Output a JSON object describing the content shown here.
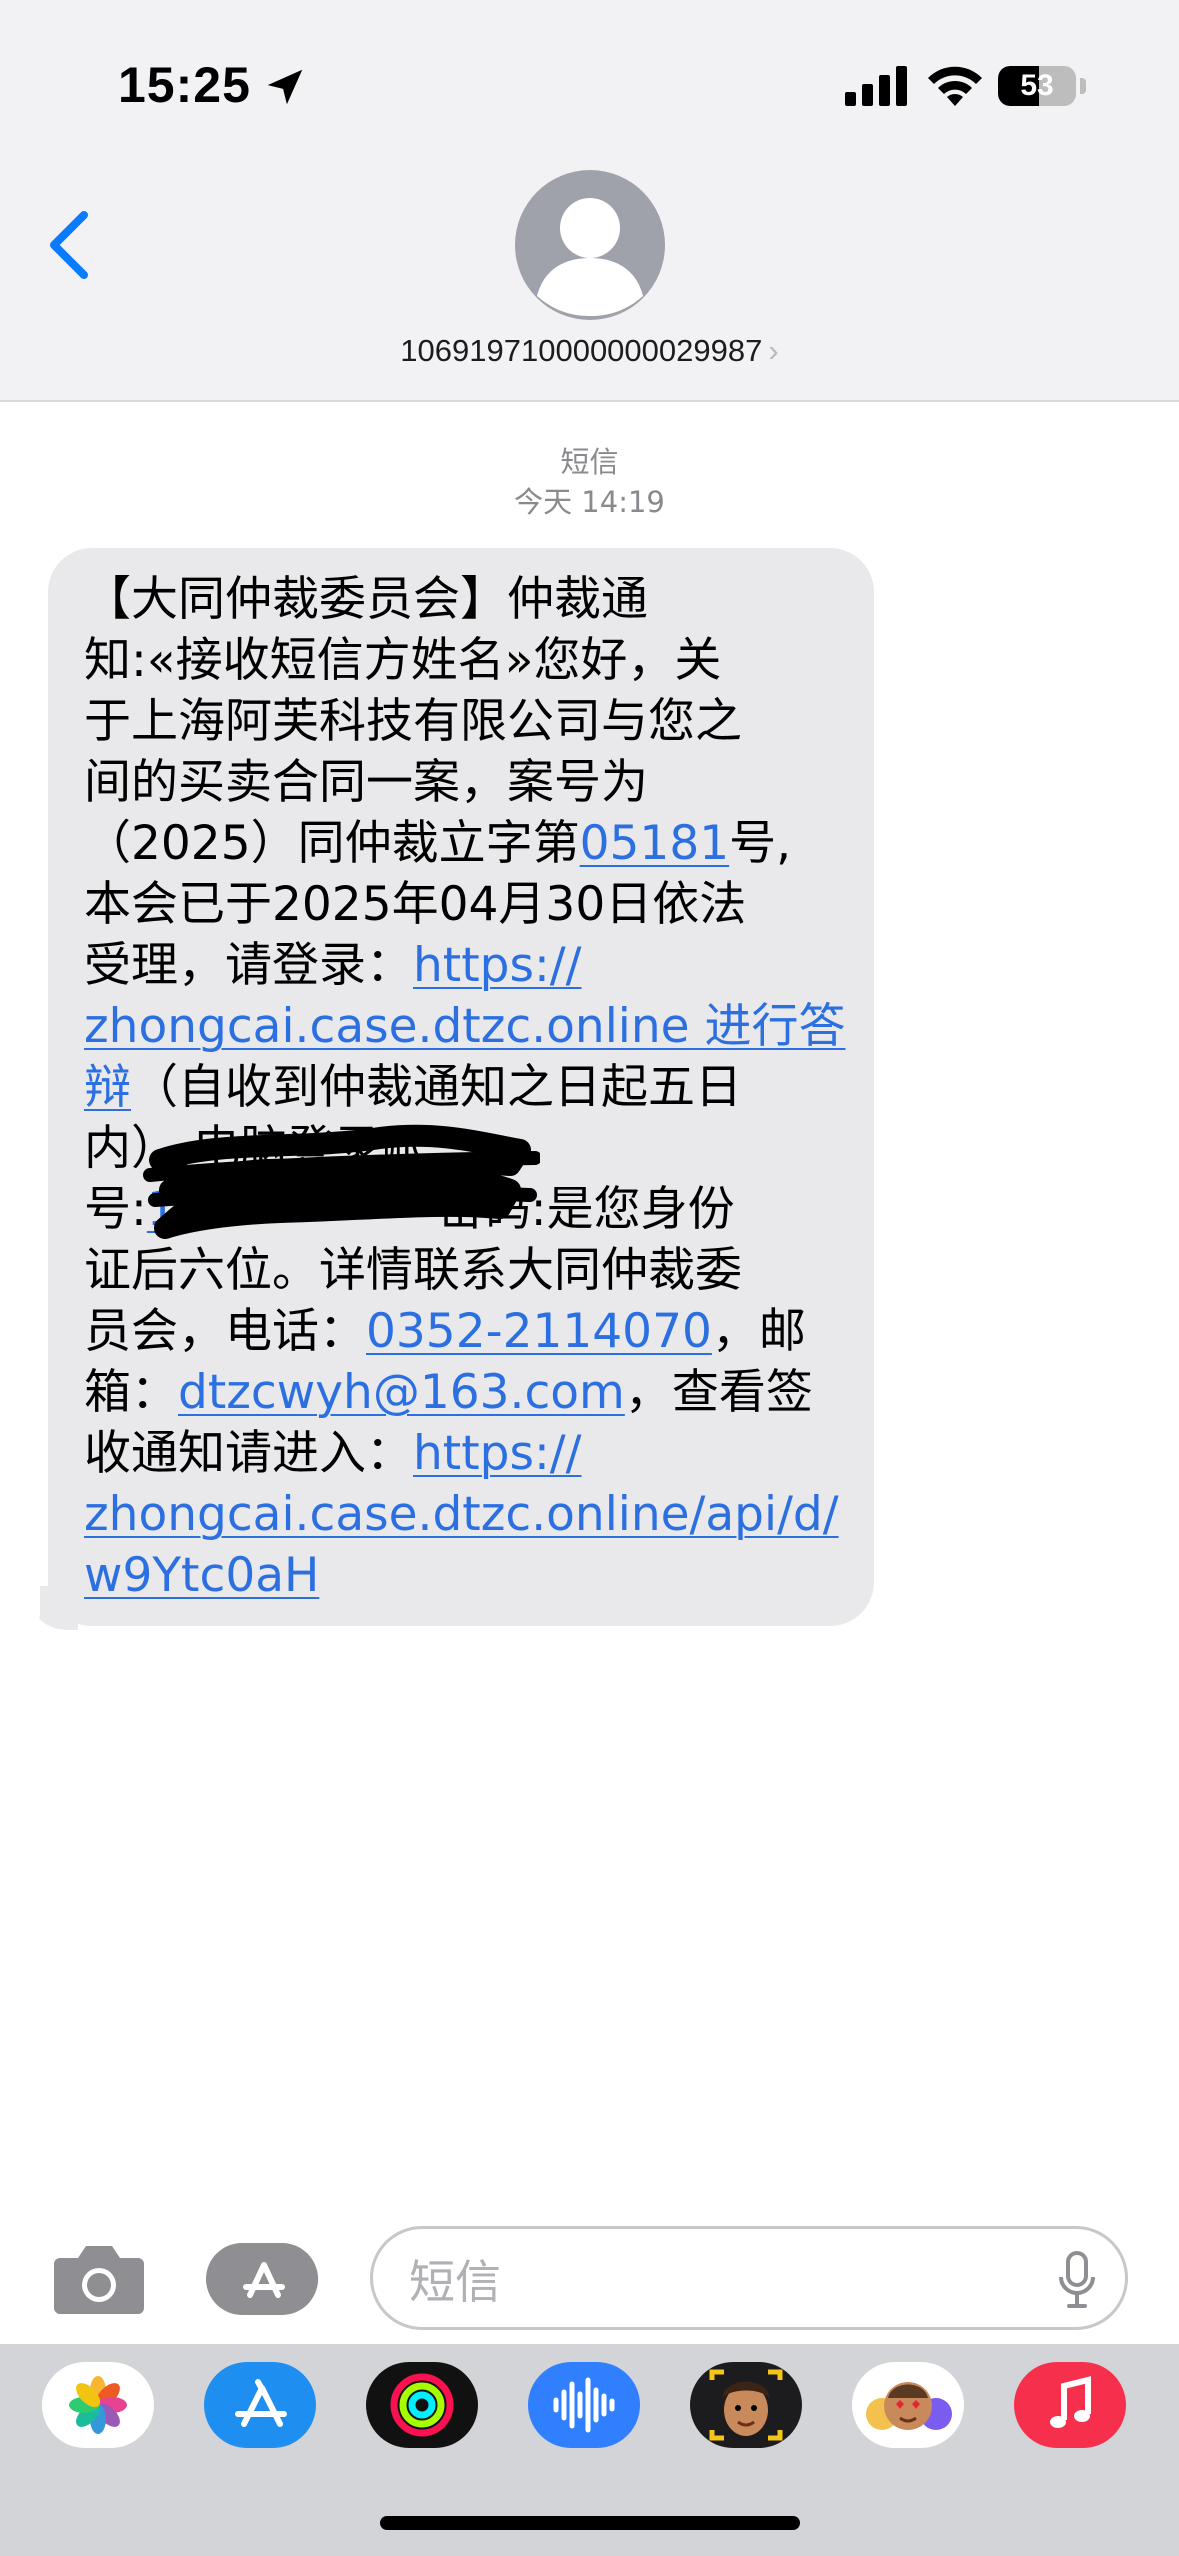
{
  "status_bar": {
    "time": "15:25",
    "battery_percent": "53",
    "battery_level": 0.53
  },
  "header": {
    "contact_name": "106919710000000029987",
    "contact_chevron": "›"
  },
  "conversation": {
    "service_label": "短信",
    "timestamp": "今天 14:19"
  },
  "message": {
    "l1": "【大同仲裁委员会】仲裁通",
    "l2": "知:«接收短信方姓名»您好，关",
    "l3": "于上海阿芙科技有限公司与您之",
    "l4": "间的买卖合同一案，案号为",
    "l5a": "（2025）同仲裁立字第",
    "l5_link": "05181",
    "l5b": "号,",
    "l6": "本会已于2025年04月30日依法",
    "l7a": "受理，请登录：",
    "l7_link": "https://",
    "l8_link": "zhongcai.case.dtzc.online 进行答",
    "l9_link": "辩",
    "l9b": "（自收到仲裁通知之日起五日",
    "l10": "内）,电脑登录账",
    "l11a": "号:",
    "l11_link": "1",
    "l11b": "密码:是您身份",
    "l12": "证后六位。详情联系大同仲裁委",
    "l13a": "员会，电话：",
    "l13_link": "0352-2114070",
    "l13b": "，邮",
    "l14a": "箱：",
    "l14_link": "dtzcwyh@163.com",
    "l14b": "，查看签",
    "l15a": "收通知请进入：",
    "l15_link": "https://",
    "l16_link": "zhongcai.case.dtzc.online/api/d/",
    "l17_link": "w9Ytc0aH"
  },
  "input": {
    "placeholder": "短信"
  },
  "app_drawer": {
    "apps": [
      "photos-icon",
      "app-store-icon",
      "activity-icon",
      "audio-message-icon",
      "memoji-icon",
      "memoji-stickers-icon",
      "music-icon"
    ]
  },
  "colors": {
    "link": "#2b6fe0",
    "bubble": "#e9e9eb",
    "accent": "#0a7aff"
  }
}
